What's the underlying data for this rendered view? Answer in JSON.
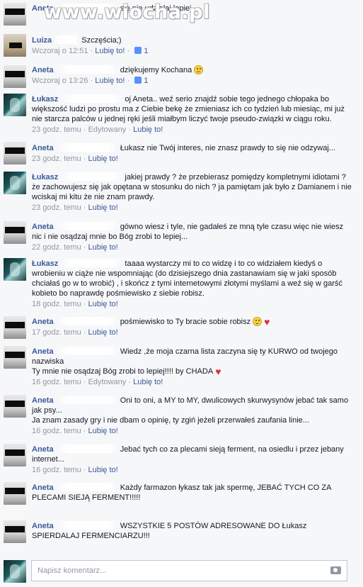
{
  "watermark": "www.wiocha.pl",
  "comments": [
    {
      "author": "Aneta",
      "text": "się nie udzielaj lepiej...",
      "meta": []
    },
    {
      "author": "Luiza",
      "text": "Szczęścia;)",
      "meta": [
        "Wczoraj o 12:51",
        "Lubię to!",
        "1"
      ]
    },
    {
      "author": "Aneta",
      "text": "dziękujemy Kochana",
      "meta": [
        "Wczoraj o 13:26",
        "Lubię to!",
        "1"
      ]
    },
    {
      "author": "Łukasz",
      "text": "oj Aneta.. weź serio znajdź sobie tego jednego chłopaka bo większość ludzi po prostu ma z Ciebie bekę że zmieniasz ich co tydzień lub miesiąc, mi już nie starcza palców u jednej ręki jeśli miałbym liczyć twoje pseudo-związki w ciągu roku.",
      "meta": [
        "23 godz. temu",
        "Edytowany",
        "Lubię to!"
      ]
    },
    {
      "author": "Aneta",
      "text": "Łukasz nie Twój interes, nie znasz prawdy to się nie odzywaj...",
      "meta": [
        "23 godz. temu",
        "Lubię to!"
      ]
    },
    {
      "author": "Łukasz",
      "text": "jakiej prawdy ? że przebierasz pomiędzy kompletnymi idiotami ? że zachowujesz się jak opętana w stosunku do nich ? ja pamiętam jak było z Damianem i nie wciskaj mi kitu że nie znam prawdy.",
      "meta": [
        "23 godz. temu",
        "Lubię to!"
      ]
    },
    {
      "author": "Aneta",
      "text": "gówno wiesz i tyle, nie gadałeś ze mną tyle czasu więc nie wiesz nic i nie osądzaj mnie bo Bóg zrobi to lepiej...",
      "meta": [
        "22 godz. temu",
        "Lubię to!"
      ]
    },
    {
      "author": "Łukasz",
      "text": "taaaa wystarczy mi to co widzę i to co widziałem kiedyś o wrobieniu w ciąże nie wspomniając (do dzisiejszego dnia zastanawiam się w jaki sposób chciałaś go w to wrobić) , i skończ z tymi internetowymi złotymi myślami a weź się w garść kobieto bo naprawdę pośmiewisko z siebie robisz.",
      "meta": [
        "18 godz. temu",
        "Lubię to!"
      ]
    },
    {
      "author": "Aneta",
      "text": "pośmiewisko to Ty bracie sobie robisz",
      "meta": [
        "17 godz. temu",
        "Lubię to!"
      ]
    },
    {
      "author": "Aneta",
      "text": "Wiedz ,że moja czarna lista zaczyna się ty KURWO od twojego nazwiska",
      "text2": "Ty mnie nie osądzaj Bóg zrobi to lepiej!!!! by CHADA",
      "meta": [
        "16 godz. temu",
        "Edytowany",
        "Lubię to!"
      ]
    },
    {
      "author": "Aneta",
      "text": "Oni to oni, a MY to MY, dwulicowych skurwysynów jebać tak samo jak psy...",
      "text2": "Ja znam zasady gry i nie dbam o opinię, ty zgiń jeżeli przerwałeś zaufania linie...",
      "meta": [
        "16 godz. temu",
        "Lubię to!"
      ]
    },
    {
      "author": "Aneta",
      "text": "Jebać tych co za plecami sieją ferment, na osiedlu i przez jebany internet...",
      "meta": [
        "16 godz. temu",
        "Lubię to!"
      ]
    },
    {
      "author": "Aneta",
      "text": "Każdy farmazon łykasz tak jak spermę, JEBAĆ TYCH CO ZA PLECAMI SIEJĄ FERMENT!!!!!",
      "meta": []
    },
    {
      "author": "Aneta",
      "text": "WSZYSTKIE 5 POSTÓW ADRESOWANE DO Łukasz SPIERDALAJ FERMENCIARZU!!!",
      "meta": []
    }
  ],
  "composer": {
    "placeholder": "Napisz komentarz..."
  }
}
